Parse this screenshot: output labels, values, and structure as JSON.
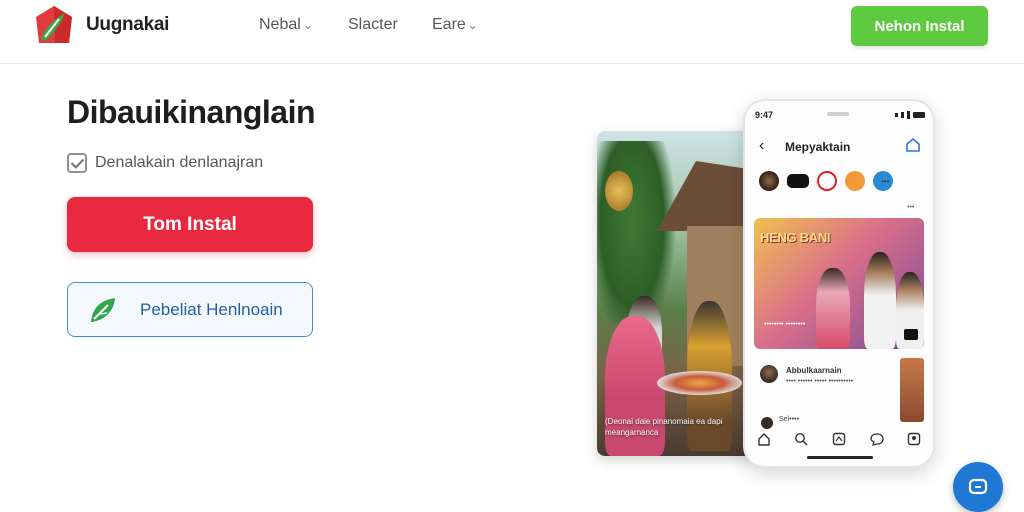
{
  "header": {
    "brand": "Uugnakai",
    "nav": [
      {
        "label": "Nebal",
        "has_dropdown": true
      },
      {
        "label": "Slacter",
        "has_dropdown": false
      },
      {
        "label": "Eare",
        "has_dropdown": true
      }
    ],
    "cta_label": "Nehon Instal"
  },
  "hero": {
    "title": "Dibauikinanglain",
    "check_label": "Denalakain denlanajran",
    "primary_button": "Tom Instal",
    "secondary_button": "Pebeliat Henlnoain"
  },
  "photo_card": {
    "caption": "(Deonai daie pinanomaia ea dapi meangarnanca"
  },
  "phone": {
    "time": "9:47",
    "title": "Mepyaktain",
    "stories_label": "•••",
    "stories_sub": "•••",
    "feature_title": "HENG BANI",
    "feature_sub": "•••••••• ••••••••",
    "post_name": "Abbulkaarnain",
    "post_text": "•••• •••••• ••••• ••••••••••",
    "post2_name": "Sel••••"
  },
  "colors": {
    "cta_green": "#5cc93e",
    "primary_red": "#e8293f",
    "secondary_blue": "#3e8fd6",
    "fab_blue": "#1e78d4"
  },
  "icons": [
    "logo-icon",
    "chevron-down-icon",
    "checkbox-icon",
    "leaf-icon",
    "back-arrow-icon",
    "share-icon",
    "home-icon",
    "search-icon",
    "add-icon",
    "chat-icon",
    "profile-icon",
    "chat-bubble-icon"
  ]
}
